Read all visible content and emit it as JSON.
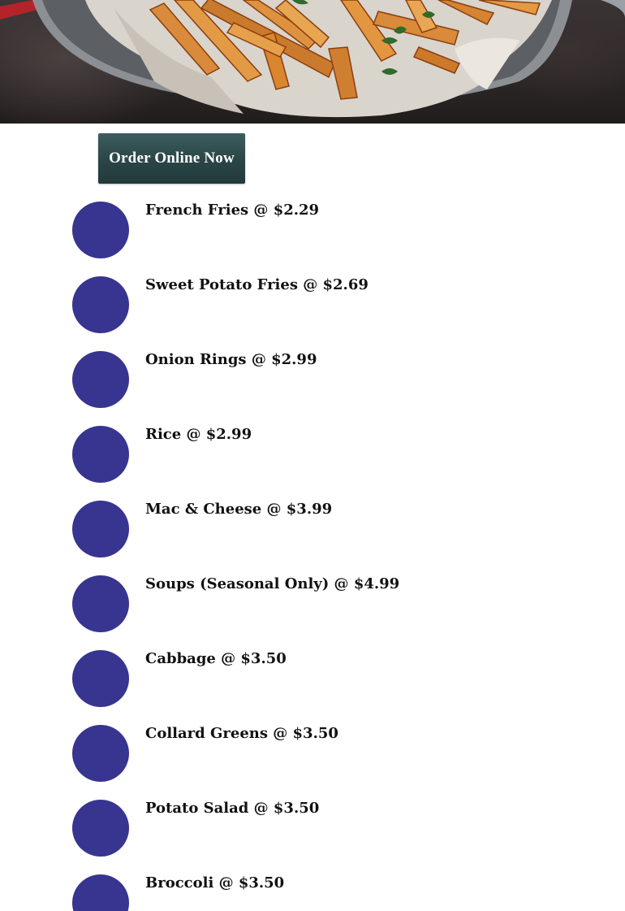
{
  "hero": {
    "icon": "french-fries-photo"
  },
  "order_button": {
    "label": "Order Online Now",
    "color": "#2a4546"
  },
  "menu": {
    "bullet_color": "#373590",
    "items": [
      {
        "label": "French Fries @ $2.29"
      },
      {
        "label": "Sweet Potato Fries @ $2.69"
      },
      {
        "label": "Onion Rings @ $2.99"
      },
      {
        "label": "Rice @ $2.99"
      },
      {
        "label": "Mac & Cheese @ $3.99"
      },
      {
        "label": "Soups (Seasonal Only) @ $4.99"
      },
      {
        "label": "Cabbage @ $3.50"
      },
      {
        "label": "Collard Greens @ $3.50"
      },
      {
        "label": "Potato Salad @ $3.50"
      },
      {
        "label": "Broccoli @ $3.50"
      }
    ]
  }
}
